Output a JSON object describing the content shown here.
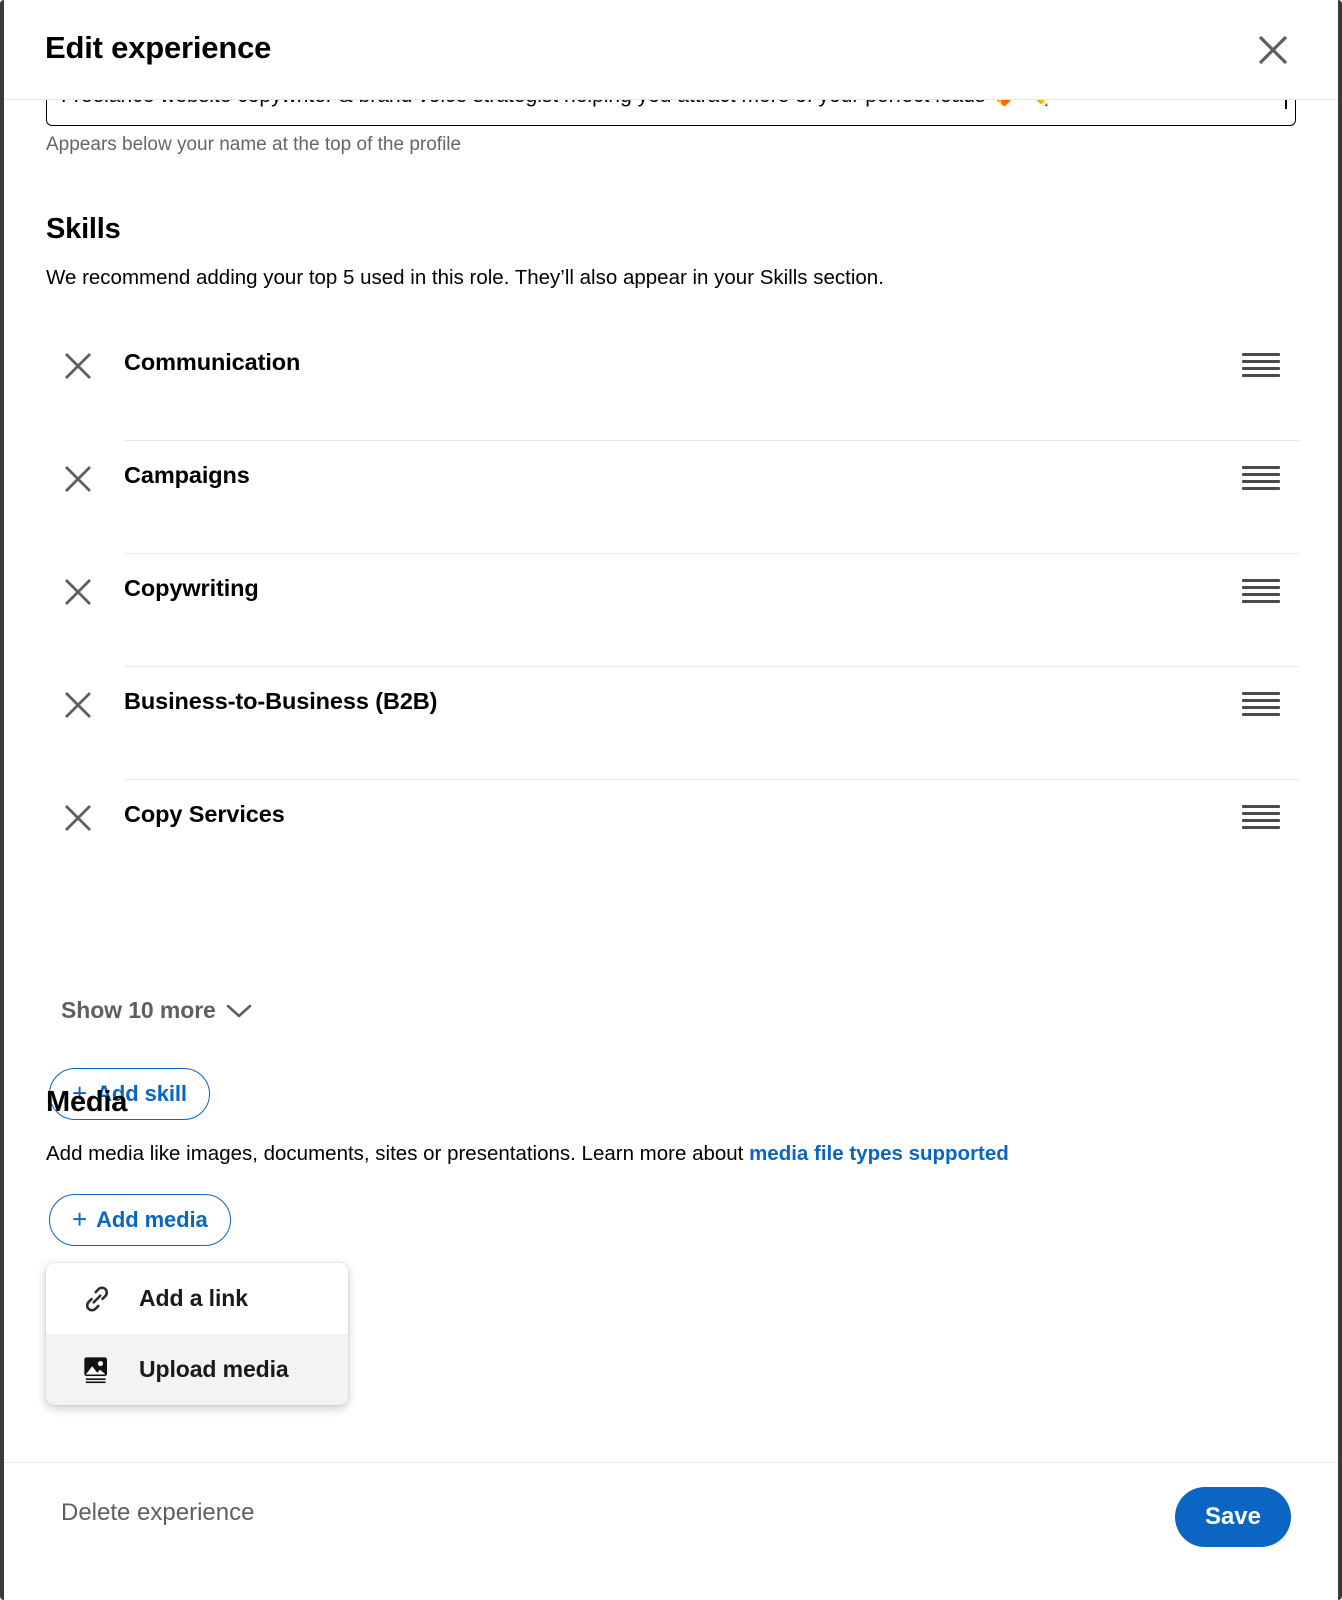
{
  "dialog": {
    "title": "Edit experience",
    "close_icon": "close-icon"
  },
  "headline": {
    "value": "Freelance website copywriter & brand voice strategist helping you attract more of your perfect leads ❤️‍🔥 ✏️",
    "hint": "Appears below your name at the top of the profile"
  },
  "skills": {
    "title": "Skills",
    "description": "We recommend adding your top 5 used in this role. They’ll also appear in your Skills section.",
    "items": [
      {
        "name": "Communication"
      },
      {
        "name": "Campaigns"
      },
      {
        "name": "Copywriting"
      },
      {
        "name": "Business-to-Business (B2B)"
      },
      {
        "name": "Copy Services"
      }
    ],
    "show_more_label": "Show 10 more",
    "add_skill_label": "Add skill",
    "add_plus": "+"
  },
  "media": {
    "title": "Media",
    "description_before": "Add media like images, documents, sites or presentations. Learn more about ",
    "link_label": "media file types supported",
    "add_media_label": "Add media",
    "add_plus": "+",
    "menu": [
      {
        "label": "Add a link",
        "icon": "link-icon"
      },
      {
        "label": "Upload media",
        "icon": "image-icon"
      }
    ]
  },
  "footer": {
    "delete_label": "Delete experience",
    "save_label": "Save"
  },
  "colors": {
    "accent": "#0a66c2",
    "text": "#000000",
    "muted": "#5f5f5f",
    "divider": "#eaeaea"
  }
}
